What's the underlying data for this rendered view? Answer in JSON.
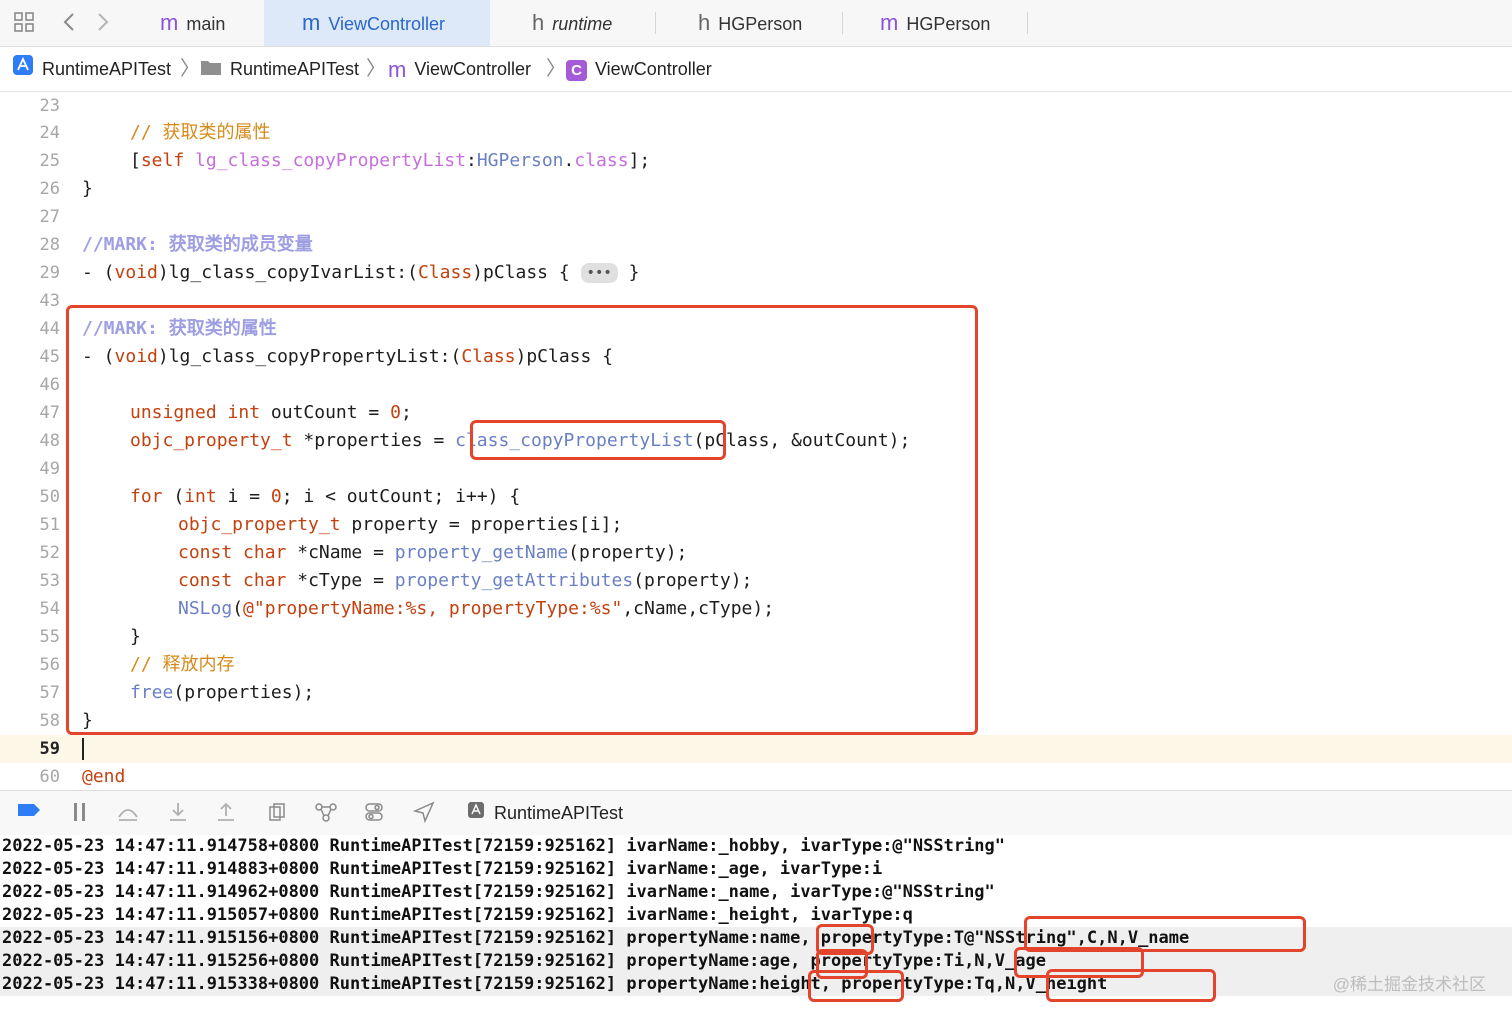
{
  "tabs": [
    {
      "prefix": "m",
      "label": "main"
    },
    {
      "prefix": "m",
      "label": "ViewController"
    },
    {
      "prefix": "h",
      "label": "runtime"
    },
    {
      "prefix": "h",
      "label": "HGPerson"
    },
    {
      "prefix": "m",
      "label": "HGPerson"
    }
  ],
  "breadcrumb": [
    "RuntimeAPITest",
    "RuntimeAPITest",
    "ViewController",
    "ViewController"
  ],
  "breadcrumb_icons": {
    "c3_prefix": "m",
    "c4_letter": "C"
  },
  "code": {
    "l23": "23",
    "l24": "24",
    "c24": "// 获取类的属性",
    "l25": "25",
    "c25a": "[",
    "c25b": "self",
    "c25c": "lg_class_copyPropertyList",
    "c25d": ":",
    "c25e": "HGPerson",
    "c25f": ".",
    "c25g": "class",
    "c25h": "];",
    "l26": "26",
    "c26": "}",
    "l27": "27",
    "l28": "28",
    "c28a": "//MARK: ",
    "c28b": "获取类的成员变量",
    "l29": "29",
    "c29a": "- (",
    "c29b": "void",
    "c29c": ")lg_class_copyIvarList:(",
    "c29d": "Class",
    "c29e": ")pClass { ",
    "c29f": "•••",
    "c29g": " }",
    "l43": "43",
    "l44": "44",
    "c44a": "//MARK: ",
    "c44b": "获取类的属性",
    "l45": "45",
    "c45a": "- (",
    "c45b": "void",
    "c45c": ")lg_class_copyPropertyList:(",
    "c45d": "Class",
    "c45e": ")pClass {",
    "l46": "46",
    "l47": "47",
    "c47a": "unsigned",
    "c47b": " ",
    "c47c": "int",
    "c47d": " outCount = ",
    "c47e": "0",
    "c47f": ";",
    "l48": "48",
    "c48a": "objc_property_t",
    "c48b": " *properties = ",
    "c48c": "class_copyPropertyList",
    "c48d": "(pClass, &outCount);",
    "l49": "49",
    "l50": "50",
    "c50a": "for",
    "c50b": " (",
    "c50c": "int",
    "c50d": " i = ",
    "c50e": "0",
    "c50f": "; i < outCount; i++) {",
    "l51": "51",
    "c51a": "objc_property_t",
    "c51b": " property = properties[i];",
    "l52": "52",
    "c52a": "const",
    "c52b": " ",
    "c52c": "char",
    "c52d": " *cName = ",
    "c52e": "property_getName",
    "c52f": "(property);",
    "l53": "53",
    "c53a": "const",
    "c53b": " ",
    "c53c": "char",
    "c53d": " *cType = ",
    "c53e": "property_getAttributes",
    "c53f": "(property);",
    "l54": "54",
    "c54a": "NSLog",
    "c54b": "(",
    "c54c": "@\"propertyName:%s, propertyType:%s\"",
    "c54d": ",cName,cType);",
    "l55": "55",
    "c55": "}",
    "l56": "56",
    "c56": "// 释放内存",
    "l57": "57",
    "c57a": "free",
    "c57b": "(properties);",
    "l58": "58",
    "c58": "}",
    "l59": "59",
    "l60": "60",
    "c60": "@end"
  },
  "debug_target": "RuntimeAPITest",
  "console": [
    "2022-05-23 14:47:11.914758+0800 RuntimeAPITest[72159:925162] ivarName:_hobby, ivarType:@\"NSString\"",
    "2022-05-23 14:47:11.914883+0800 RuntimeAPITest[72159:925162] ivarName:_age, ivarType:i",
    "2022-05-23 14:47:11.914962+0800 RuntimeAPITest[72159:925162] ivarName:_name, ivarType:@\"NSString\"",
    "2022-05-23 14:47:11.915057+0800 RuntimeAPITest[72159:925162] ivarName:_height, ivarType:q",
    "2022-05-23 14:47:11.915156+0800 RuntimeAPITest[72159:925162] propertyName:name, propertyType:T@\"NSString\",C,N,V_name",
    "2022-05-23 14:47:11.915256+0800 RuntimeAPITest[72159:925162] propertyName:age, propertyType:Ti,N,V_age",
    "2022-05-23 14:47:11.915338+0800 RuntimeAPITest[72159:925162] propertyName:height, propertyType:Tq,N,V_height"
  ],
  "watermark": "@稀土掘金技术社区",
  "colors": {
    "highlight_box": "#e2452b",
    "active_tab": "#2a67c8",
    "keyword": "#c3410f",
    "comment": "#d58a1a"
  }
}
